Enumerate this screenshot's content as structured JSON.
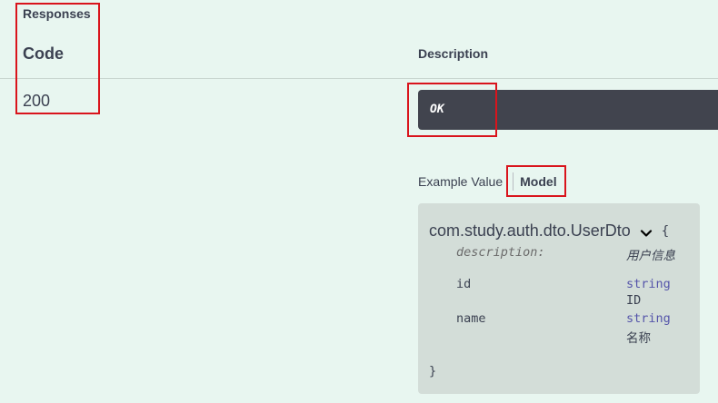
{
  "responses": {
    "title": "Responses",
    "columns": {
      "code": "Code",
      "description": "Description"
    },
    "rows": [
      {
        "code": "200",
        "description": "OK"
      }
    ]
  },
  "tabs": {
    "example_value": "Example Value",
    "model": "Model",
    "active": "Model"
  },
  "model": {
    "name": "com.study.auth.dto.UserDto",
    "open_brace": "{",
    "close_brace": "}",
    "description_key": "description:",
    "description_value": "用户信息",
    "properties": [
      {
        "name": "id",
        "type": "string",
        "desc": "ID"
      },
      {
        "name": "name",
        "type": "string",
        "desc": "名称"
      }
    ]
  },
  "colors": {
    "background": "#e8f6f0",
    "ok_box": "#41444e",
    "model_box": "#d3ddd8",
    "type_text": "#55a",
    "annotation_red": "#d9141c"
  },
  "icons": {
    "expand": "chevron-down-icon"
  }
}
